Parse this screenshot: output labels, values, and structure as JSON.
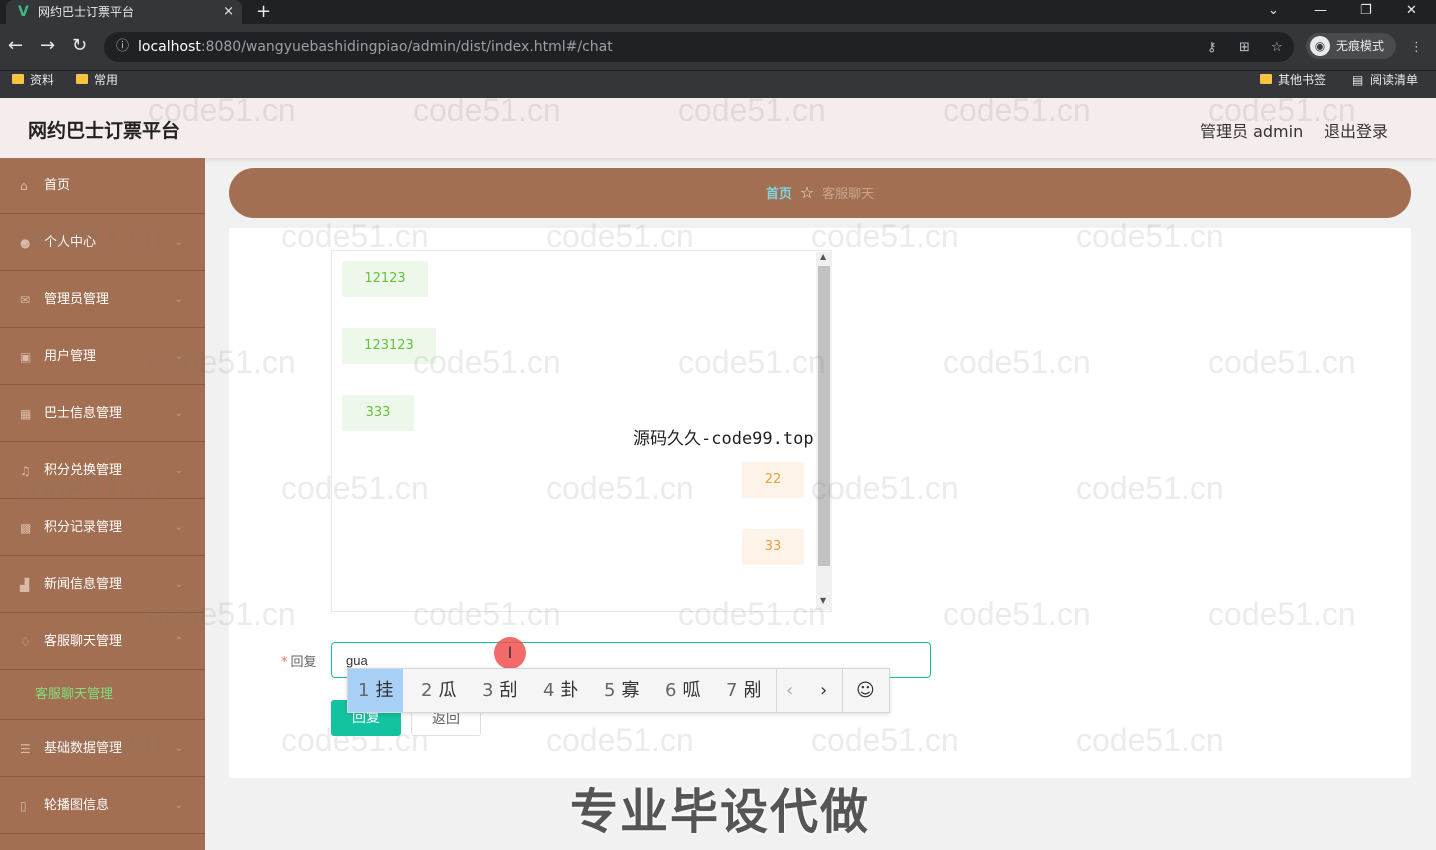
{
  "browser": {
    "tab_title": "网约巴士订票平台",
    "tab_favicon": "V",
    "tab_close": "×",
    "new_tab": "+",
    "url_host": "localhost",
    "url_path": ":8080/wangyuebashidingpiao/admin/dist/index.html#/chat",
    "incognito_label": "无痕模式",
    "bookmarks": [
      "资料",
      "常用"
    ],
    "other_bookmarks": "其他书签",
    "reading_list": "阅读清单"
  },
  "header": {
    "title": "网约巴士订票平台",
    "user": "管理员 admin",
    "logout": "退出登录"
  },
  "sidebar": {
    "items": [
      {
        "label": "首页",
        "icon": "home-icon"
      },
      {
        "label": "个人中心",
        "icon": "user-icon"
      },
      {
        "label": "管理员管理",
        "icon": "mail-icon"
      },
      {
        "label": "用户管理",
        "icon": "users-icon"
      },
      {
        "label": "巴士信息管理",
        "icon": "bus-icon"
      },
      {
        "label": "积分兑换管理",
        "icon": "mic-icon"
      },
      {
        "label": "积分记录管理",
        "icon": "grid-icon"
      },
      {
        "label": "新闻信息管理",
        "icon": "chart-icon"
      },
      {
        "label": "客服聊天管理",
        "icon": "bell-icon"
      },
      {
        "label": "基础数据管理",
        "icon": "list-icon"
      },
      {
        "label": "轮播图信息",
        "icon": "phone-icon"
      }
    ],
    "sub_item": "客服聊天管理"
  },
  "breadcrumb": {
    "home": "首页",
    "current": "客服聊天"
  },
  "chat": {
    "left_messages": [
      "12123",
      "123123",
      "333"
    ],
    "right_messages": [
      "22",
      "33"
    ]
  },
  "form": {
    "reply_label": "回复",
    "reply_value": "gua",
    "reply_button": "回复",
    "back_button": "返回"
  },
  "ime": {
    "candidates": [
      {
        "num": "1",
        "char": "挂"
      },
      {
        "num": "2",
        "char": "瓜"
      },
      {
        "num": "3",
        "char": "刮"
      },
      {
        "num": "4",
        "char": "卦"
      },
      {
        "num": "5",
        "char": "寡"
      },
      {
        "num": "6",
        "char": "呱"
      },
      {
        "num": "7",
        "char": "剐"
      }
    ],
    "prev": "‹",
    "next": "›",
    "emoji": "☺"
  },
  "watermarks": {
    "site": "code51.cn",
    "center": "源码久久-code99.top",
    "bottom": "专业毕设代做"
  },
  "colors": {
    "sidebar": "#a26f52",
    "accent": "#13c2a0",
    "header_bg": "#f5ecec"
  }
}
